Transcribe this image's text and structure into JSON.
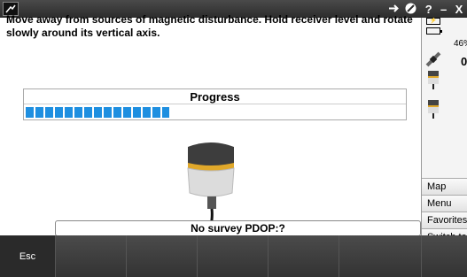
{
  "instruction": "Move away from sources of magnetic disturbance. Hold receiver level and rotate slowly around its vertical axis.",
  "progress": {
    "label": "Progress",
    "fraction": 0.38
  },
  "status": {
    "line": "No survey  PDOP:?"
  },
  "softkeys": {
    "esc_label": "Esc"
  },
  "window_controls": {
    "help": "?",
    "minimize": "–",
    "close": "X"
  },
  "right_panel": {
    "battery_pct": "46%",
    "sat_count": "0",
    "buttons": [
      "Map",
      "Menu",
      "Favorites",
      "Switch to"
    ]
  },
  "icons": [
    "app-icon",
    "charge-icon",
    "battery-icon",
    "satellite-icon",
    "receiver-icon",
    "no-entry-icon",
    "arrow-icon"
  ],
  "colors": {
    "accent": "#1e8fe0",
    "titlebar": "#2c2c2c",
    "bottombar": "#3a3a3a"
  }
}
